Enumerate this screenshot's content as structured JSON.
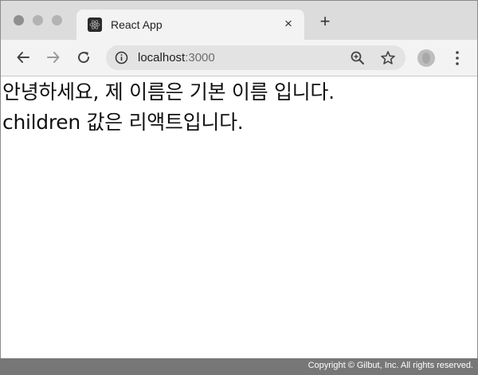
{
  "browser": {
    "tab": {
      "title": "React App",
      "favicon": "react-logo-icon",
      "close": "×"
    },
    "new_tab": "+",
    "toolbar": {
      "back": "back-arrow-icon",
      "forward": "forward-arrow-icon",
      "reload": "reload-icon",
      "url_host": "localhost",
      "url_port": ":3000",
      "zoom": "zoom-icon",
      "bookmark": "star-icon",
      "menu": "kebab-menu-icon"
    }
  },
  "page": {
    "line1": "안녕하세요, 제 이름은 기본 이름 입니다.",
    "line2": "children 값은 리액트입니다."
  },
  "footer": {
    "copyright": "Copyright © Gilbut, Inc. All rights reserved."
  }
}
